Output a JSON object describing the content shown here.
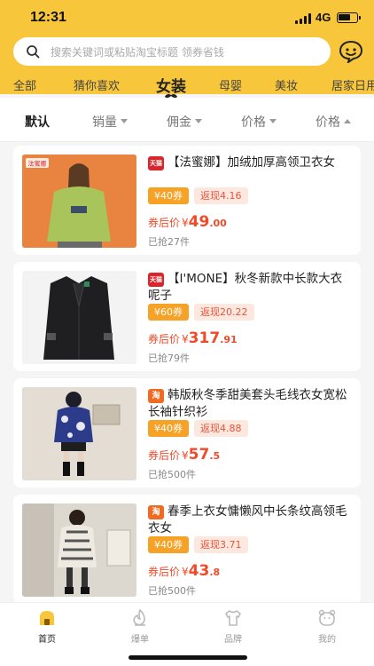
{
  "status": {
    "time": "12:31",
    "network": "4G"
  },
  "search": {
    "placeholder": "搜索关键词或粘贴淘宝标题 领券省钱"
  },
  "categories": [
    {
      "label": "全部"
    },
    {
      "label": "猜你喜欢"
    },
    {
      "label": "女装"
    },
    {
      "label": "母婴"
    },
    {
      "label": "美妆"
    },
    {
      "label": "居家日用"
    }
  ],
  "sort": [
    {
      "label": "默认"
    },
    {
      "label": "销量"
    },
    {
      "label": "佣金"
    },
    {
      "label": "价格"
    },
    {
      "label": "价格"
    }
  ],
  "products": [
    {
      "shop": "天猫",
      "title": "【法蜜娜】加绒加厚高领卫衣女",
      "coupon": "¥40券",
      "cashback": "返现4.16",
      "price_label": "券后价",
      "currency": "¥",
      "price_int": "49",
      "price_dec": ".00",
      "sold": "已抢27件",
      "thumb_badge": "法蜜娜"
    },
    {
      "shop": "天猫",
      "title": "【I'MONE】秋冬新款中长款大衣呢子",
      "coupon": "¥60券",
      "cashback": "返现20.22",
      "price_label": "券后价",
      "currency": "¥",
      "price_int": "317",
      "price_dec": ".91",
      "sold": "已抢79件"
    },
    {
      "shop": "淘",
      "title": "韩版秋冬季甜美套头毛线衣女宽松长袖针织衫",
      "coupon": "¥40券",
      "cashback": "返现4.88",
      "price_label": "券后价",
      "currency": "¥",
      "price_int": "57",
      "price_dec": ".5",
      "sold": "已抢500件"
    },
    {
      "shop": "淘",
      "title": "春季上衣女慵懒风中长条纹高领毛衣女",
      "coupon": "¥40券",
      "cashback": "返现3.71",
      "price_label": "券后价",
      "currency": "¥",
      "price_int": "43",
      "price_dec": ".8",
      "sold": "已抢500件"
    }
  ],
  "tabs": [
    {
      "label": "首页"
    },
    {
      "label": "爆单"
    },
    {
      "label": "品牌"
    },
    {
      "label": "我的"
    }
  ],
  "colors": {
    "brand": "#f7c63a",
    "price": "#f04a2a",
    "coupon": "#f6a227",
    "tmall": "#d8262c",
    "taobao": "#f26a21"
  }
}
